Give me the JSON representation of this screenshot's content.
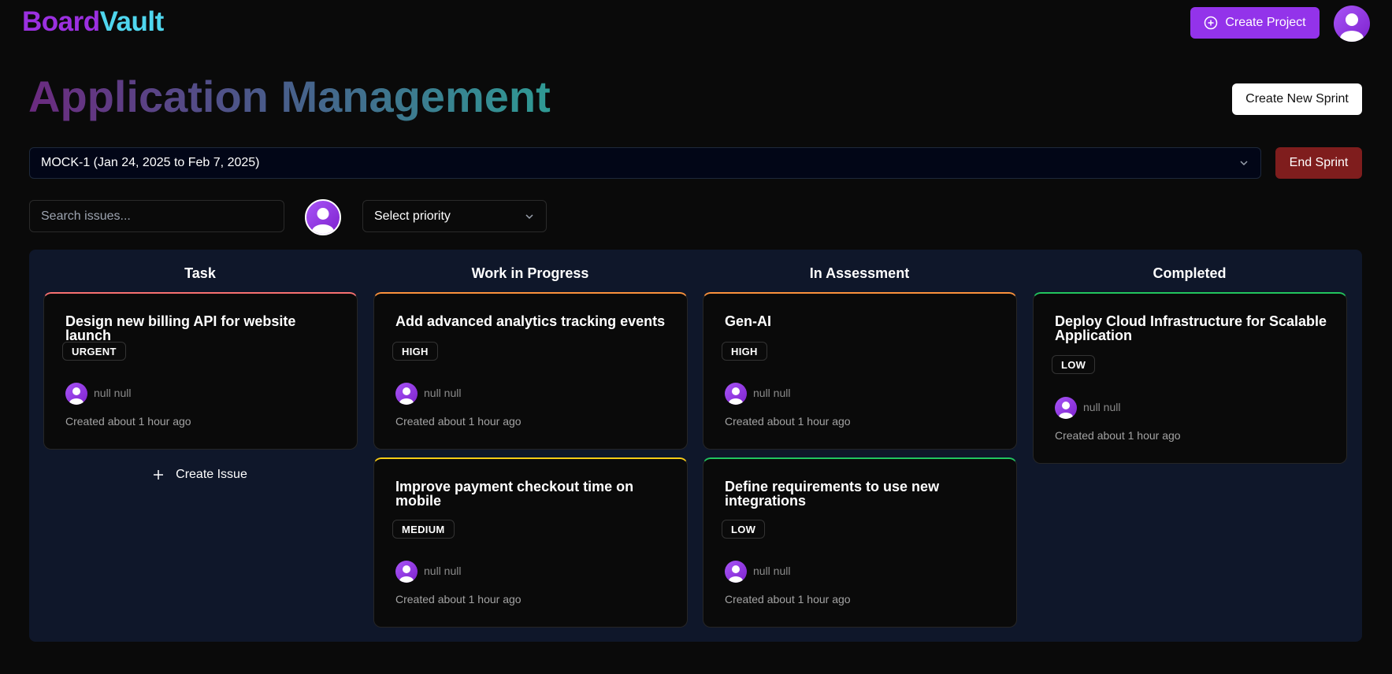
{
  "header": {
    "logo_part1": "Board",
    "logo_part2": "Vault",
    "create_project_label": "Create Project"
  },
  "page": {
    "title": "Application Management",
    "create_sprint_label": "Create New Sprint",
    "end_sprint_label": "End Sprint"
  },
  "sprint_select": {
    "value": "MOCK-1 (Jan 24, 2025 to Feb 7, 2025)"
  },
  "filters": {
    "search_placeholder": "Search issues...",
    "priority_placeholder": "Select priority"
  },
  "board": {
    "columns": [
      {
        "title": "Task"
      },
      {
        "title": "Work in Progress"
      },
      {
        "title": "In Assessment"
      },
      {
        "title": "Completed"
      }
    ],
    "create_issue_label": "Create Issue"
  },
  "cards": [
    {
      "title": "Design new billing API for website launch",
      "priority": "URGENT",
      "assignee": "null null",
      "created": "Created about 1 hour ago",
      "accent": "#f87171"
    },
    {
      "title": "Add advanced analytics tracking events",
      "priority": "HIGH",
      "assignee": "null null",
      "created": "Created about 1 hour ago",
      "accent": "#fb923c"
    },
    {
      "title": "Improve payment checkout time on mobile",
      "priority": "MEDIUM",
      "assignee": "null null",
      "created": "Created about 1 hour ago",
      "accent": "#facc15"
    },
    {
      "title": "Gen-AI",
      "priority": "HIGH",
      "assignee": "null null",
      "created": "Created about 1 hour ago",
      "accent": "#fb923c"
    },
    {
      "title": "Define requirements to use new integrations",
      "priority": "LOW",
      "assignee": "null null",
      "created": "Created about 1 hour ago",
      "accent": "#22c55e"
    },
    {
      "title": "Deploy Cloud Infrastructure for Scalable Application",
      "priority": "LOW",
      "assignee": "null null",
      "created": "Created about 1 hour ago",
      "accent": "#22c55e"
    }
  ],
  "colors": {
    "accent_purple": "#9333ea",
    "end_sprint_red": "#7f1d1d",
    "board_bg": "#0f172a"
  }
}
